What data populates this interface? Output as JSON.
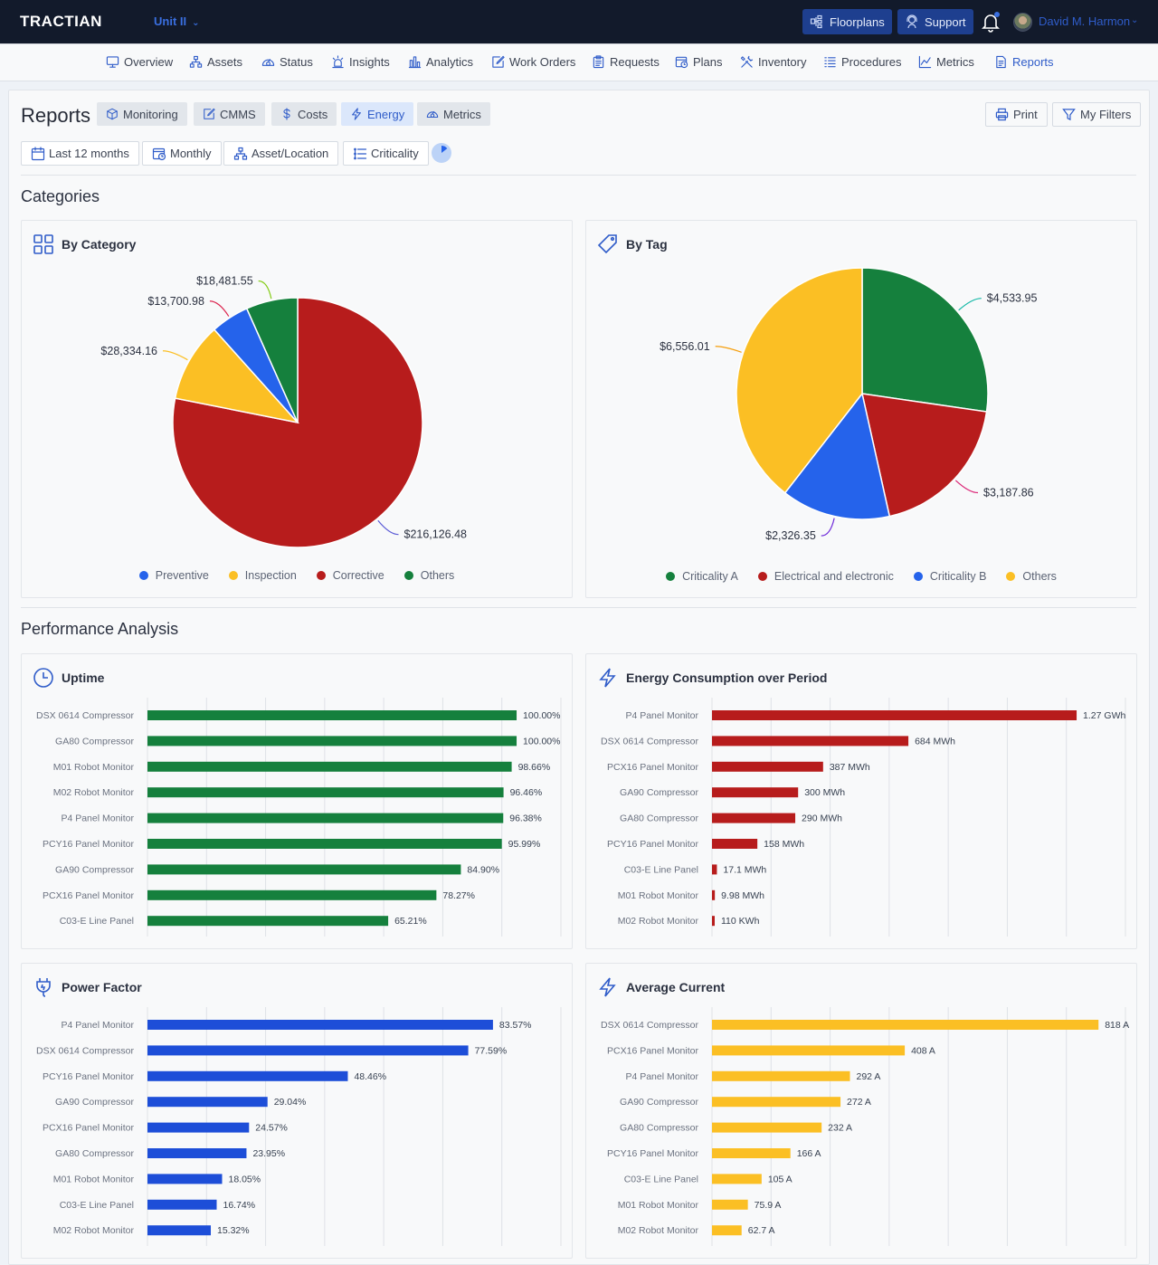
{
  "app": {
    "logo": "TRACTIAN",
    "unit": "Unit II",
    "floorplans": "Floorplans",
    "support": "Support",
    "user_name": "David M. Harmon",
    "accent": "#2f5cc9"
  },
  "nav": {
    "items": [
      {
        "label": "Overview",
        "icon": "monitor-icon"
      },
      {
        "label": "Assets",
        "icon": "hierarchy-icon"
      },
      {
        "label": "Status",
        "icon": "gauge-icon"
      },
      {
        "label": "Insights",
        "icon": "alarm-icon"
      },
      {
        "label": "Analytics",
        "icon": "bar-chart-icon"
      },
      {
        "label": "Work Orders",
        "icon": "edit-icon"
      },
      {
        "label": "Requests",
        "icon": "clipboard-icon"
      },
      {
        "label": "Plans",
        "icon": "calendar-clock-icon"
      },
      {
        "label": "Inventory",
        "icon": "tools-icon"
      },
      {
        "label": "Procedures",
        "icon": "checklist-icon"
      },
      {
        "label": "Metrics",
        "icon": "line-chart-icon"
      },
      {
        "label": "Reports",
        "icon": "document-icon",
        "active": true
      }
    ]
  },
  "page": {
    "title": "Reports",
    "tabs": [
      {
        "label": "Monitoring",
        "icon": "cube-icon"
      },
      {
        "label": "CMMS",
        "icon": "edit-icon"
      },
      {
        "label": "Costs",
        "icon": "dollar-icon"
      },
      {
        "label": "Energy",
        "icon": "bolt-icon",
        "active": true
      },
      {
        "label": "Metrics",
        "icon": "gauge-icon"
      }
    ],
    "print": "Print",
    "my_filters": "My Filters",
    "filters": [
      {
        "label": "Last 12 months",
        "icon": "calendar-icon"
      },
      {
        "label": "Monthly",
        "icon": "calendar-clock-icon"
      },
      {
        "label": "Asset/Location",
        "icon": "hierarchy-icon"
      },
      {
        "label": "Criticality",
        "icon": "list-icon"
      }
    ],
    "sections": {
      "categories": "Categories",
      "performance": "Performance Analysis"
    }
  },
  "chart_data": [
    {
      "type": "pie",
      "title": "By Category",
      "slices": [
        {
          "name": "Corrective",
          "value": 216126.48,
          "label": "$216,126.48",
          "color": "#b71c1c",
          "leader": "#5b5bd6"
        },
        {
          "name": "Inspection",
          "value": 28334.16,
          "label": "$28,334.16",
          "color": "#fbbf24",
          "leader": "#fbbf24"
        },
        {
          "name": "Preventive",
          "value": 13700.98,
          "label": "$13,700.98",
          "color": "#2563eb",
          "leader": "#dc2650"
        },
        {
          "name": "Others",
          "value": 18481.55,
          "label": "$18,481.55",
          "color": "#15803d",
          "leader": "#84cc16"
        }
      ],
      "legend": [
        {
          "name": "Preventive",
          "color": "#2563eb"
        },
        {
          "name": "Inspection",
          "color": "#fbbf24"
        },
        {
          "name": "Corrective",
          "color": "#b71c1c"
        },
        {
          "name": "Others",
          "color": "#15803d"
        }
      ],
      "legend_position": "bottom"
    },
    {
      "type": "pie",
      "title": "By Tag",
      "slices": [
        {
          "name": "Criticality A",
          "value": 4533.95,
          "label": "$4,533.95",
          "color": "#15803d",
          "leader": "#14b8a6"
        },
        {
          "name": "Electrical and electronic",
          "value": 3187.86,
          "label": "$3,187.86",
          "color": "#b71c1c",
          "leader": "#db2777"
        },
        {
          "name": "Criticality B",
          "value": 2326.35,
          "label": "$2,326.35",
          "color": "#2563eb",
          "leader": "#6d28d9"
        },
        {
          "name": "Others",
          "value": 6556.01,
          "label": "$6,556.01",
          "color": "#fbbf24",
          "leader": "#f59e0b"
        }
      ],
      "legend": [
        {
          "name": "Criticality A",
          "color": "#15803d"
        },
        {
          "name": "Electrical and electronic",
          "color": "#b71c1c"
        },
        {
          "name": "Criticality B",
          "color": "#2563eb"
        },
        {
          "name": "Others",
          "color": "#fbbf24"
        }
      ],
      "legend_position": "bottom"
    },
    {
      "type": "bar",
      "orientation": "horizontal",
      "title": "Uptime",
      "color": "#15803d",
      "unit": "%",
      "xlim": [
        0,
        112
      ],
      "categories": [
        "DSX 0614 Compressor",
        "GA80 Compressor",
        "M01 Robot Monitor",
        "M02 Robot Monitor",
        "P4 Panel Monitor",
        "PCY16 Panel Monitor",
        "GA90 Compressor",
        "PCX16 Panel Monitor",
        "C03-E Line Panel"
      ],
      "values": [
        100.0,
        100.0,
        98.66,
        96.46,
        96.38,
        95.99,
        84.9,
        78.27,
        65.21
      ],
      "labels": [
        "100.00%",
        "100.00%",
        "98.66%",
        "96.46%",
        "96.38%",
        "95.99%",
        "84.90%",
        "78.27%",
        "65.21%"
      ],
      "grid": true
    },
    {
      "type": "bar",
      "orientation": "horizontal",
      "title": "Energy Consumption over Period",
      "color": "#b71c1c",
      "unit": "MWh",
      "xlim": [
        0,
        1440
      ],
      "categories": [
        "P4 Panel Monitor",
        "DSX 0614 Compressor",
        "PCX16 Panel Monitor",
        "GA90 Compressor",
        "GA80 Compressor",
        "PCY16 Panel Monitor",
        "C03-E Line Panel",
        "M01 Robot Monitor",
        "M02 Robot Monitor"
      ],
      "values": [
        1270,
        684,
        387,
        300,
        290,
        158,
        17.1,
        9.98,
        0.11
      ],
      "labels": [
        "1.27 GWh",
        "684 MWh",
        "387 MWh",
        "300 MWh",
        "290 MWh",
        "158 MWh",
        "17.1 MWh",
        "9.98 MWh",
        "110 KWh"
      ],
      "grid": true
    },
    {
      "type": "bar",
      "orientation": "horizontal",
      "title": "Power Factor",
      "color": "#1d4ed8",
      "unit": "%",
      "xlim": [
        0,
        100
      ],
      "categories": [
        "P4 Panel Monitor",
        "DSX 0614 Compressor",
        "PCY16 Panel Monitor",
        "GA90 Compressor",
        "PCX16 Panel Monitor",
        "GA80 Compressor",
        "M01 Robot Monitor",
        "C03-E Line Panel",
        "M02 Robot Monitor"
      ],
      "values": [
        83.57,
        77.59,
        48.46,
        29.04,
        24.57,
        23.95,
        18.05,
        16.74,
        15.32
      ],
      "labels": [
        "83.57%",
        "77.59%",
        "48.46%",
        "29.04%",
        "24.57%",
        "23.95%",
        "18.05%",
        "16.74%",
        "15.32%"
      ],
      "grid": true
    },
    {
      "type": "bar",
      "orientation": "horizontal",
      "title": "Average Current",
      "color": "#fbbf24",
      "unit": "A",
      "xlim": [
        0,
        875
      ],
      "categories": [
        "DSX 0614 Compressor",
        "PCX16 Panel Monitor",
        "P4 Panel Monitor",
        "GA90 Compressor",
        "GA80 Compressor",
        "PCY16 Panel Monitor",
        "C03-E Line Panel",
        "M01 Robot Monitor",
        "M02 Robot Monitor"
      ],
      "values": [
        818,
        408,
        292,
        272,
        232,
        166,
        105,
        75.9,
        62.7
      ],
      "labels": [
        "818 A",
        "408 A",
        "292 A",
        "272 A",
        "232 A",
        "166 A",
        "105 A",
        "75.9 A",
        "62.7 A"
      ],
      "grid": true
    }
  ]
}
